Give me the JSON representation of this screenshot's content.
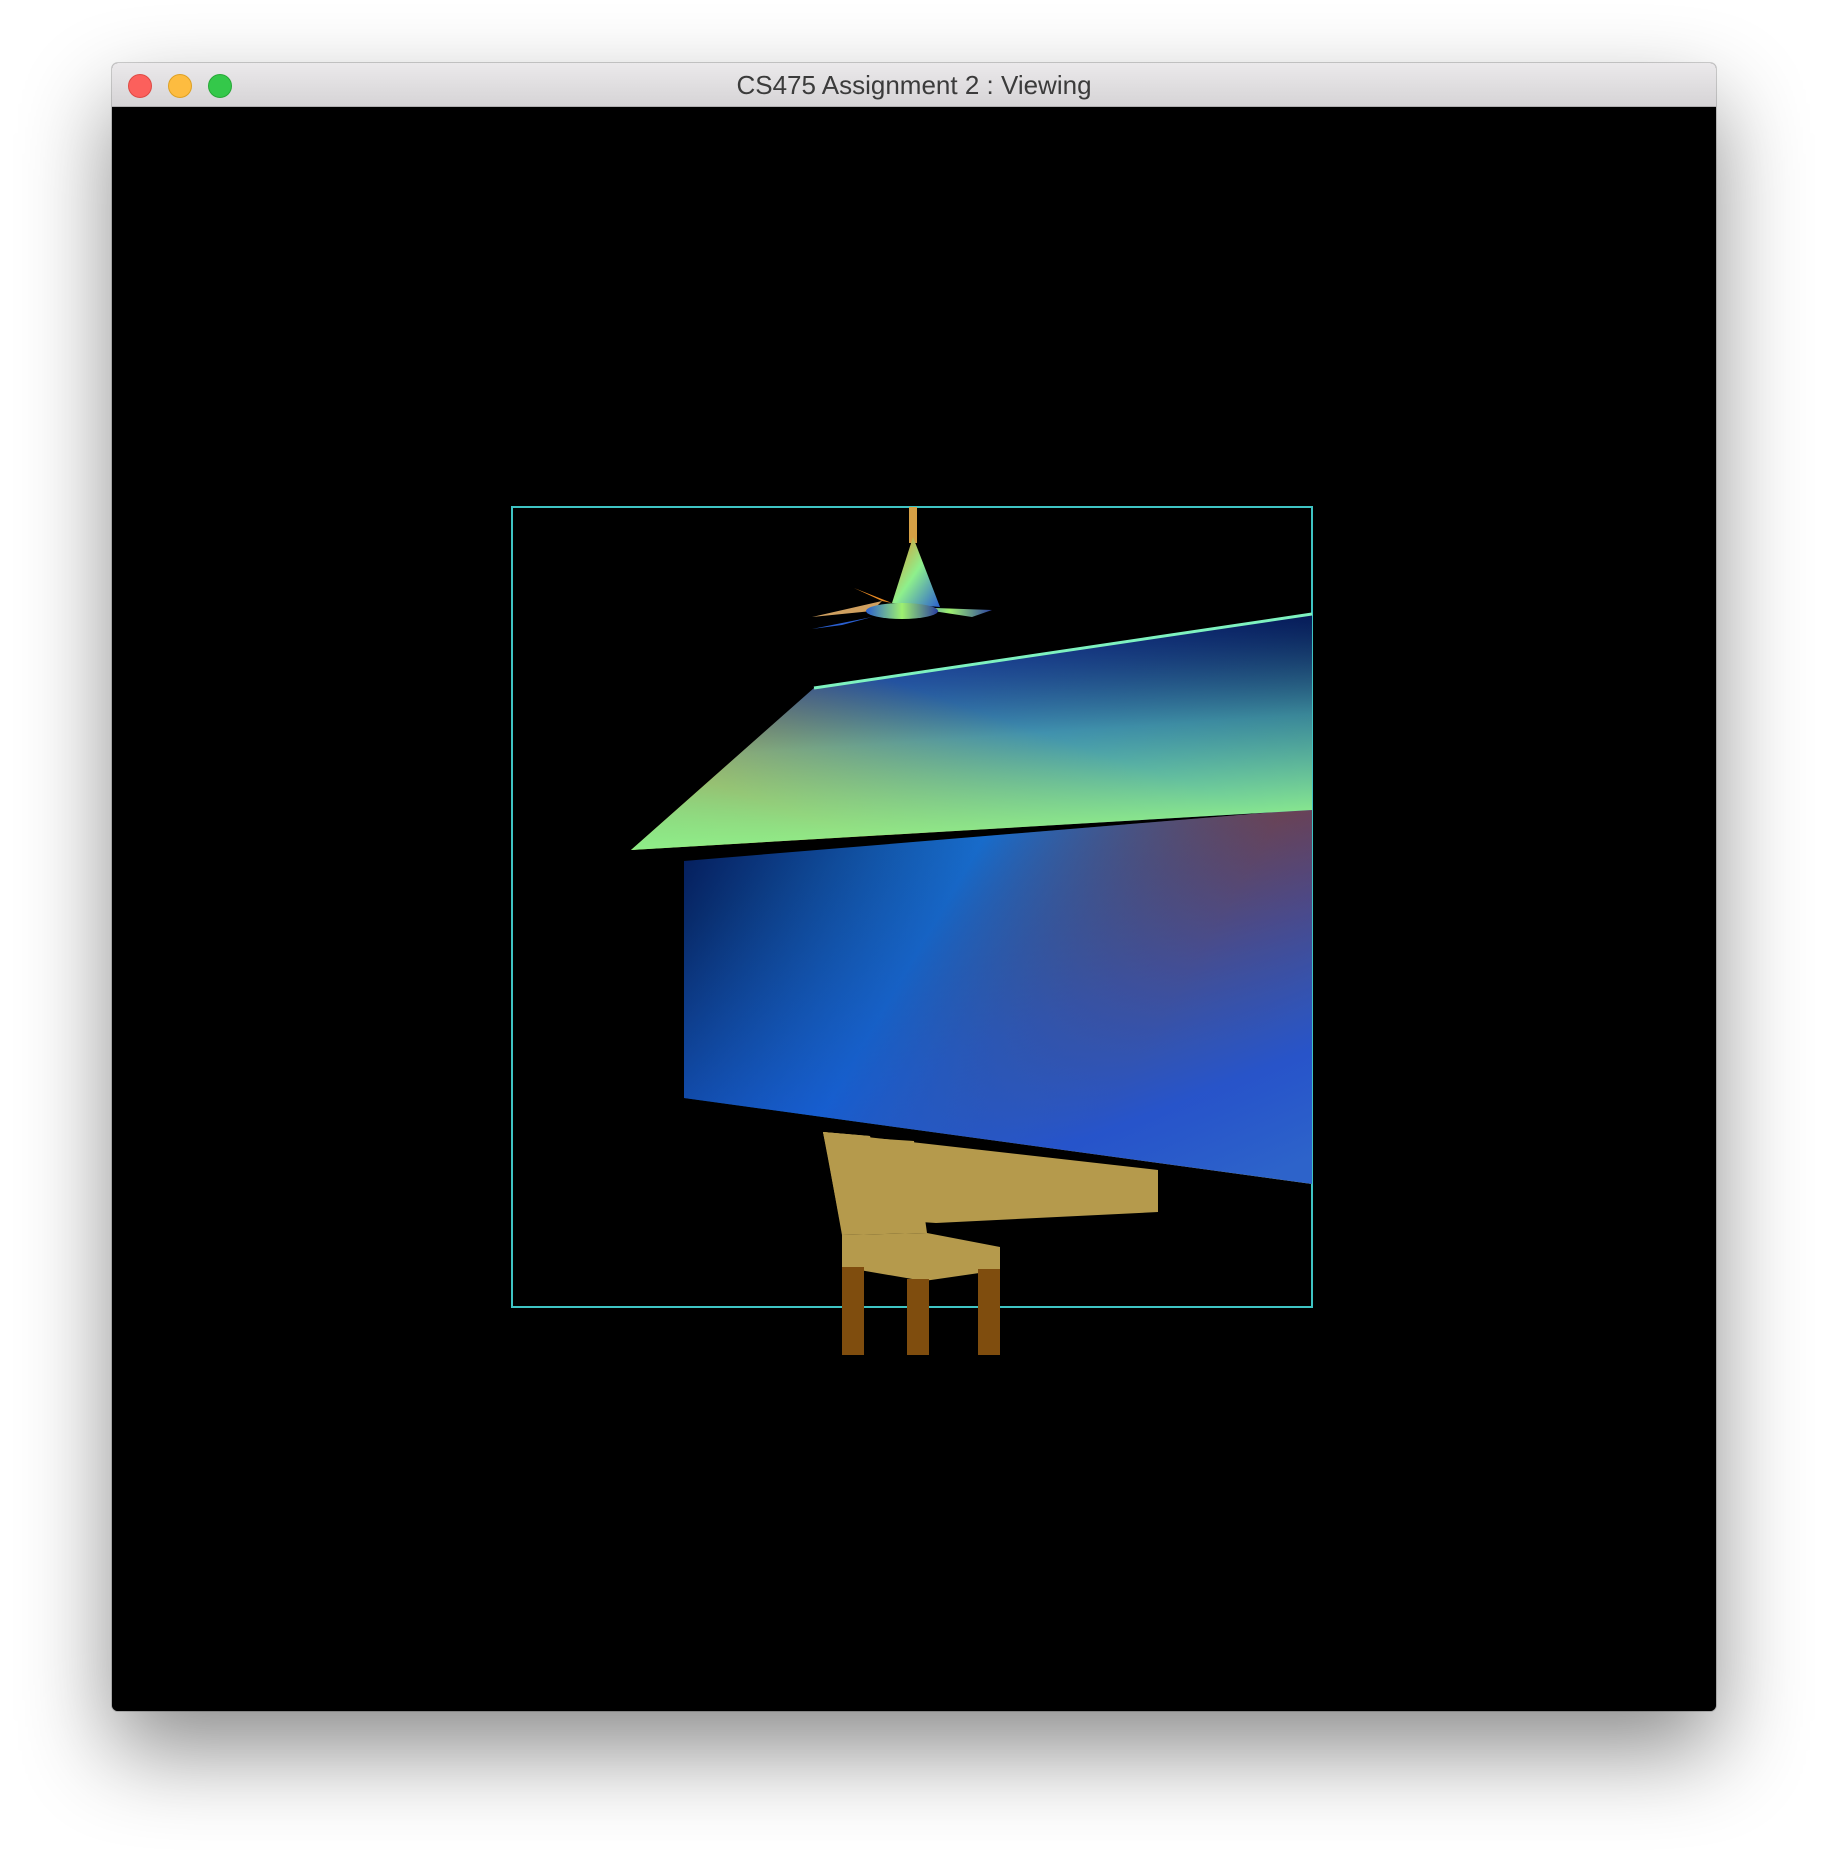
{
  "window": {
    "title": "CS475 Assignment 2 : Viewing",
    "controls": [
      "close",
      "minimize",
      "zoom"
    ]
  },
  "canvas": {
    "background": "#000000",
    "frame_color": "#3fc4c4",
    "scene_objects": [
      "ceiling-fan",
      "roof",
      "wall",
      "chair"
    ],
    "colors": {
      "chair_seat": "#b59a4c",
      "chair_legs": "#7f4d0e",
      "roof_orange": "#e98a23",
      "roof_blue": "#0a30b0",
      "roof_green": "#7ef29a",
      "wall_navy": "#0a1a60",
      "wall_blue": "#1877e0",
      "wall_red": "#b8320f",
      "wall_green": "#9ef070"
    }
  }
}
